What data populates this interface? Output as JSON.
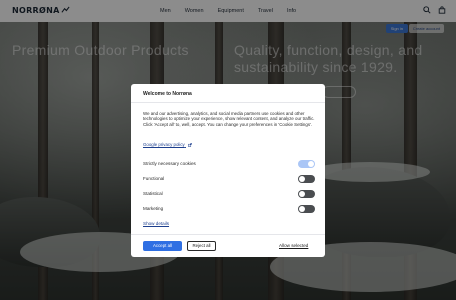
{
  "header": {
    "logo_text": "NORRØNA",
    "nav": [
      {
        "label": "Men"
      },
      {
        "label": "Women"
      },
      {
        "label": "Equipment"
      },
      {
        "label": "Travel"
      },
      {
        "label": "Info"
      }
    ],
    "icons": [
      "search-icon",
      "bag-icon"
    ]
  },
  "account": {
    "sign_in": "Sign in",
    "create": "Create account"
  },
  "hero": {
    "title_left": "Premium Outdoor Products",
    "title_right": "Quality, function, design, and sustainability since 1929."
  },
  "consent": {
    "title": "Welcome to Norrøna",
    "body": "We and our advertising, analytics, and social media partners use cookies and other technologies to optimize your experience, show relevant content, and analyze our traffic. Click 'Accept all' to, well, accept. You can change your preferences in 'Cookie Settings'.",
    "policy_link": "Google privacy policy",
    "toggles": [
      {
        "label": "Strictly necessary cookies",
        "state": "on"
      },
      {
        "label": "Functional",
        "state": "off"
      },
      {
        "label": "Statistical",
        "state": "off"
      },
      {
        "label": "Marketing",
        "state": "off"
      }
    ],
    "show_details": "Show details",
    "accept_all": "Accept all",
    "reject_all": "Reject all",
    "allow_selected": "Allow selected"
  },
  "colors": {
    "accent": "#2f6fe3",
    "toggle_on": "#aac6f6",
    "toggle_off": "#4a4d50",
    "link": "#1d3f8e"
  }
}
